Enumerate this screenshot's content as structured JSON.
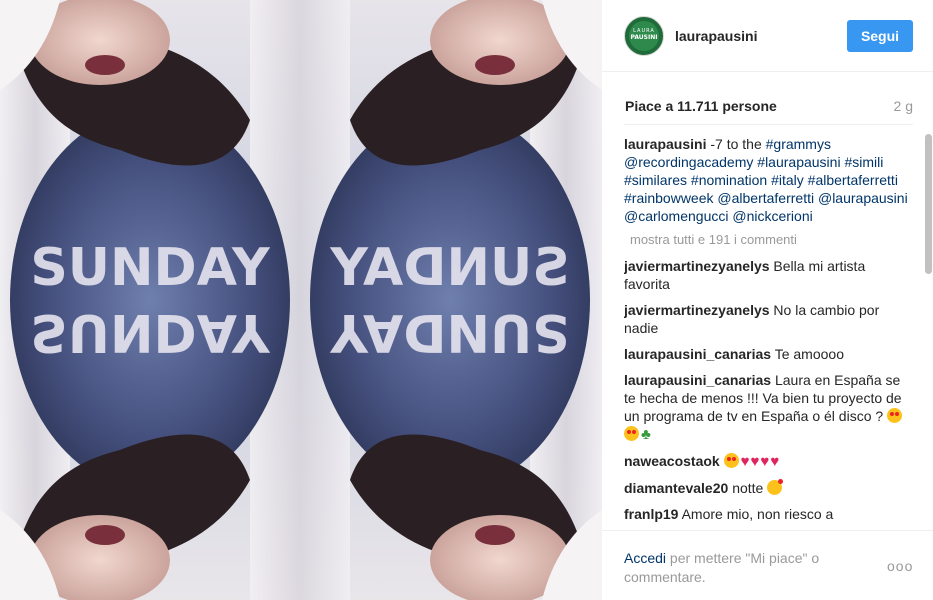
{
  "header": {
    "avatar_top": "LAURA",
    "avatar_name": "PAUSINI",
    "username": "laurapausini",
    "follow_label": "Segui"
  },
  "stats": {
    "likes": "Piace a 11.711 persone",
    "age": "2 g"
  },
  "caption": {
    "user": "laurapausini",
    "text_start": "-7 to the",
    "tags": [
      "#grammys",
      "@recordingacademy",
      "#laurapausini",
      "#simili",
      "#similares",
      "#nomination",
      "#italy",
      "#albertaferretti",
      "#rainbowweek",
      "@albertaferretti",
      "@laurapausini",
      "@carlomengucci",
      "@nickcerioni"
    ]
  },
  "show_all": "mostra tutti e 191 i commenti",
  "comments": [
    {
      "user": "javiermartinezyanelys",
      "text": "Bella mi artista favorita"
    },
    {
      "user": "javiermartinezyanelys",
      "text": "No la cambio por nadie"
    },
    {
      "user": "laurapausini_canarias",
      "text": "Te amoooo"
    },
    {
      "user": "laurapausini_canarias",
      "text": "Laura en España se te hecha de menos !!! Va bien tu proyecto de un programa de tv en España o él disco ?"
    },
    {
      "user": "naweacostaok",
      "text": ""
    },
    {
      "user": "diamantevale20",
      "text": "notte"
    },
    {
      "user": "franlp19",
      "text": "Amore mio, non riesco a"
    }
  ],
  "footer": {
    "login_link": "Accedi",
    "login_rest": " per mettere \"Mi piace\" o commentare.",
    "more_options": "ooo"
  },
  "photo": {
    "shirt_text": "SUNDAY"
  },
  "colors": {
    "accent": "#3897f0",
    "link": "#003569",
    "muted": "#999999",
    "avatar_bg": "#1f6b3a"
  }
}
